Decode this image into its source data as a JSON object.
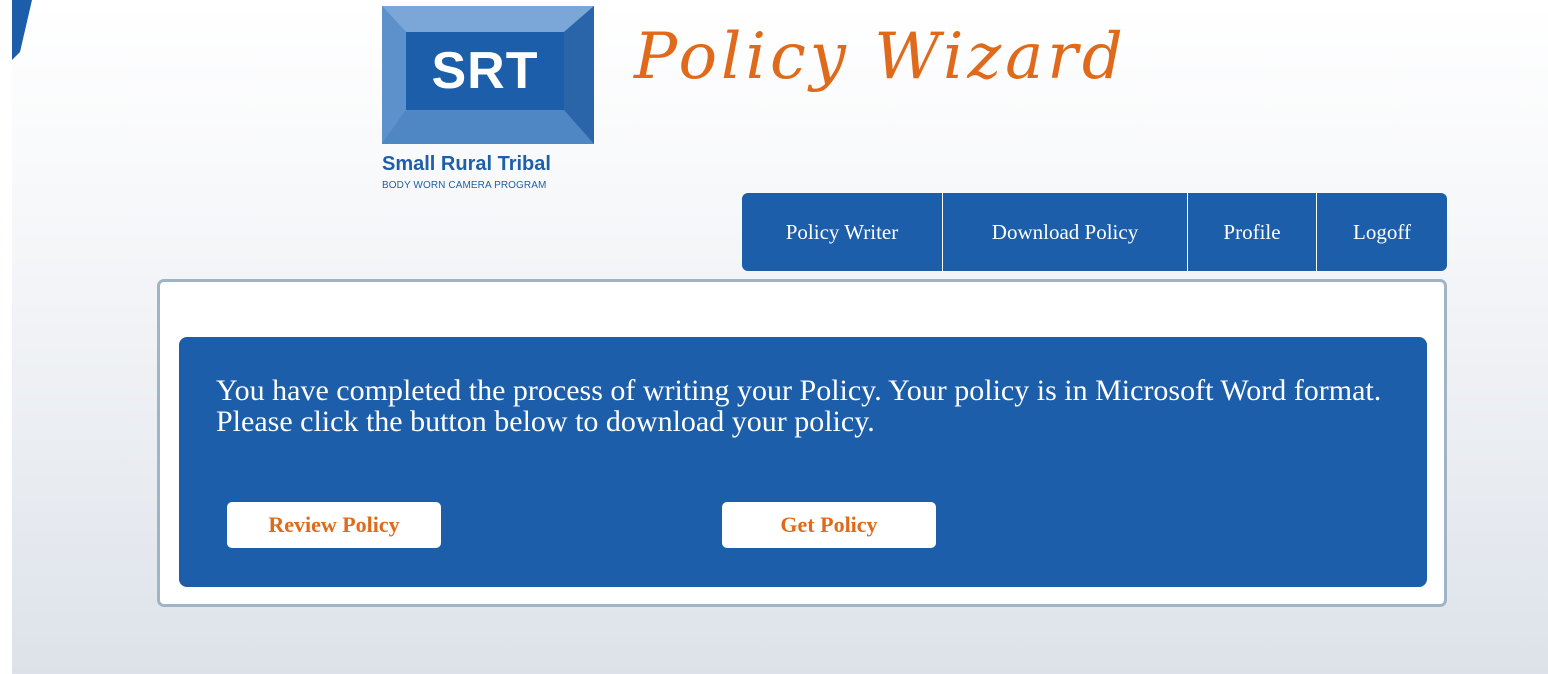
{
  "colors": {
    "brand_blue": "#1c5ea9",
    "accent_orange": "#e06a1c",
    "panel_border": "#9fb5c6"
  },
  "logo": {
    "abbr": "SRT",
    "name": "Small Rural Tribal",
    "tagline": "BODY WORN CAMERA PROGRAM"
  },
  "header": {
    "title": "Policy Wizard"
  },
  "nav": {
    "items": [
      {
        "label": "Policy Writer"
      },
      {
        "label": "Download Policy"
      },
      {
        "label": "Profile"
      },
      {
        "label": "Logoff"
      }
    ]
  },
  "main": {
    "message": "You have completed the process of writing your Policy. Your policy is in Microsoft Word format. Please click the button below to download your policy.",
    "review_button": "Review Policy",
    "get_button": "Get Policy"
  }
}
